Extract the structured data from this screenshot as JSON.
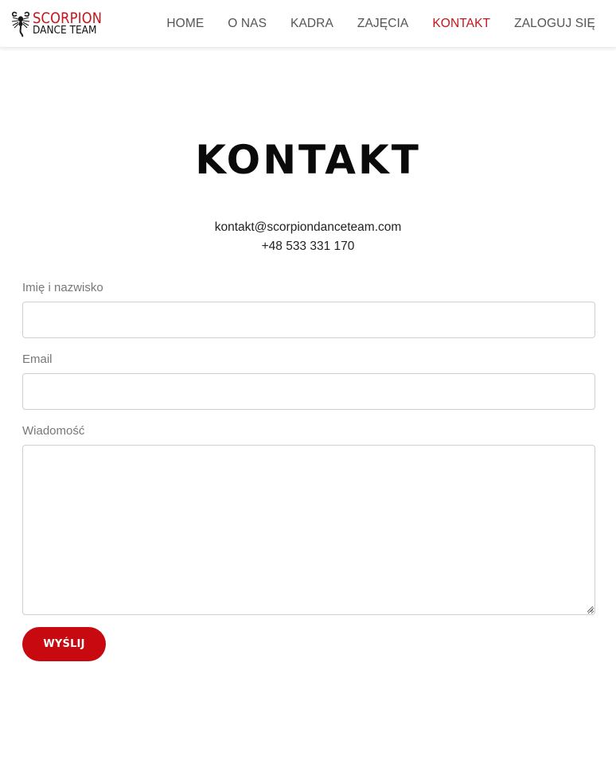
{
  "header": {
    "logo": {
      "line1": "SCORPION",
      "line2": "DANCE TEAM",
      "icon": "scorpion-icon"
    },
    "nav": [
      {
        "label": "HOME",
        "active": false
      },
      {
        "label": "O NAS",
        "active": false
      },
      {
        "label": "KADRA",
        "active": false
      },
      {
        "label": "ZAJĘCIA",
        "active": false
      },
      {
        "label": "KONTAKT",
        "active": true
      },
      {
        "label": "ZALOGUJ SIĘ",
        "active": false
      }
    ]
  },
  "main": {
    "title": "KONTAKT",
    "email": "kontakt@scorpiondanceteam.com",
    "phone": "+48 533 331 170",
    "form": {
      "name_label": "Imię i nazwisko",
      "name_value": "",
      "email_label": "Email",
      "email_value": "",
      "message_label": "Wiadomość",
      "message_value": "",
      "submit_label": "WYŚLIJ"
    }
  },
  "colors": {
    "accent": "#c8141a",
    "button": "#c80a10",
    "text": "#222222",
    "label": "#777777"
  }
}
